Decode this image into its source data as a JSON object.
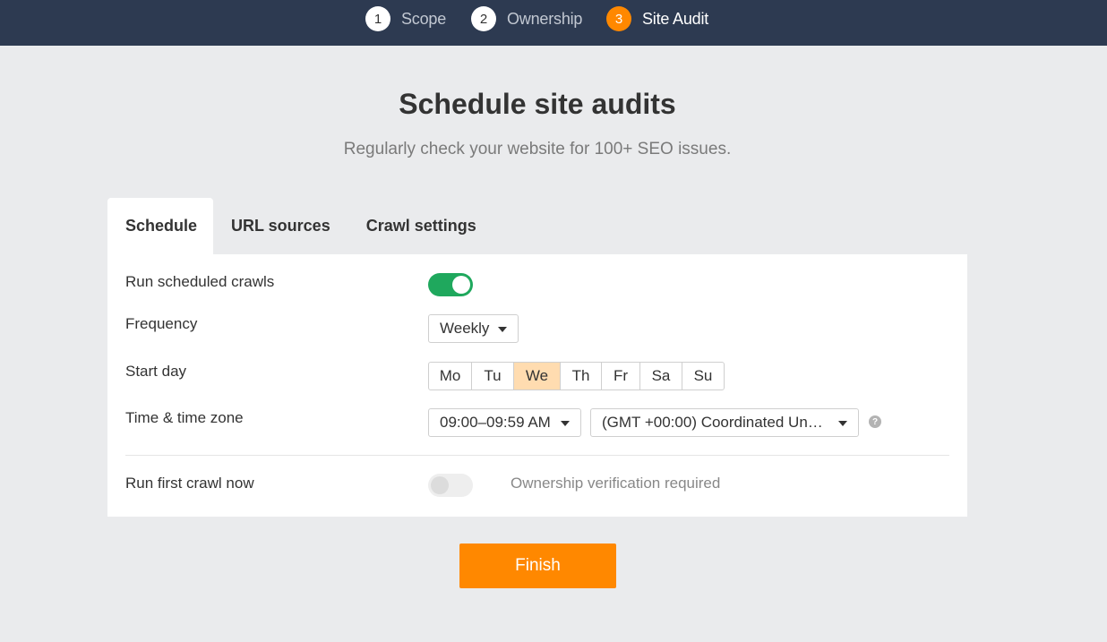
{
  "steps": [
    {
      "num": "1",
      "label": "Scope"
    },
    {
      "num": "2",
      "label": "Ownership"
    },
    {
      "num": "3",
      "label": "Site Audit"
    }
  ],
  "header": {
    "title": "Schedule site audits",
    "subtitle": "Regularly check your website for 100+ SEO issues."
  },
  "tabs": [
    "Schedule",
    "URL sources",
    "Crawl settings"
  ],
  "form": {
    "run_scheduled_label": "Run scheduled crawls",
    "run_scheduled_on": true,
    "frequency_label": "Frequency",
    "frequency_value": "Weekly",
    "start_day_label": "Start day",
    "days": [
      "Mo",
      "Tu",
      "We",
      "Th",
      "Fr",
      "Sa",
      "Su"
    ],
    "selected_day": "We",
    "time_label": "Time & time zone",
    "time_value": "09:00–09:59 AM",
    "timezone_value": "(GMT +00:00) Coordinated Un…",
    "help_glyph": "?",
    "run_first_label": "Run first crawl now",
    "run_first_on": false,
    "ownership_note": "Ownership verification required"
  },
  "finish_label": "Finish",
  "colors": {
    "topbar": "#2d3a51",
    "accent": "#ff8800",
    "toggle_on": "#1fa85d",
    "day_selected": "#ffdcb0"
  }
}
